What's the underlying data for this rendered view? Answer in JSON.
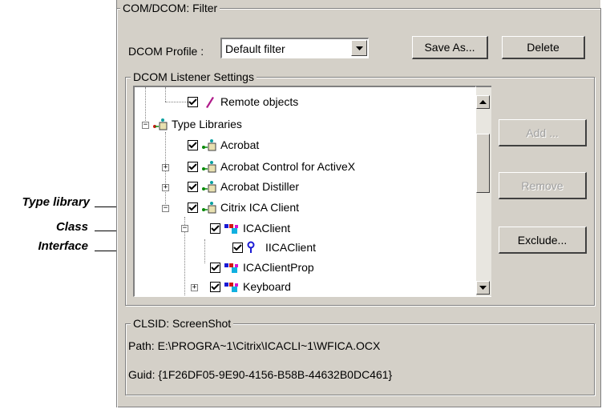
{
  "filter_group": {
    "title": "COM/DCOM: Filter"
  },
  "profile": {
    "label": "DCOM Profile :",
    "value": "Default filter"
  },
  "buttons": {
    "save_as": "Save As...",
    "delete": "Delete",
    "add": "Add ...",
    "remove": "Remove",
    "exclude": "Exclude..."
  },
  "listener_group": {
    "title": "DCOM Listener Settings"
  },
  "tree": {
    "items": [
      {
        "label": "Remote objects",
        "checked": true,
        "icon": "pencil-icon"
      },
      {
        "label": "Type Libraries",
        "checked": false,
        "icon": "type-library-icon"
      },
      {
        "label": "Acrobat",
        "checked": true,
        "icon": "type-library-icon"
      },
      {
        "label": "Acrobat Control for ActiveX",
        "checked": true,
        "icon": "type-library-icon"
      },
      {
        "label": "Acrobat Distiller",
        "checked": true,
        "icon": "type-library-icon"
      },
      {
        "label": "Citrix ICA Client",
        "checked": true,
        "icon": "type-library-icon"
      },
      {
        "label": "ICAClient",
        "checked": true,
        "icon": "class-icon"
      },
      {
        "label": "IICAClient",
        "checked": true,
        "icon": "interface-icon"
      },
      {
        "label": "ICAClientProp",
        "checked": true,
        "icon": "class-icon"
      },
      {
        "label": "Keyboard",
        "checked": true,
        "icon": "class-icon"
      }
    ]
  },
  "callouts": {
    "type_library": "Type library",
    "class": "Class",
    "interface": "Interface"
  },
  "clsid_group": {
    "title": "CLSID: ScreenShot",
    "path": "Path: E:\\PROGRA~1\\Citrix\\ICACLI~1\\WFICA.OCX",
    "guid": "Guid: {1F26DF05-9E90-4156-B58B-44632B0DC461}"
  },
  "colors": {
    "window_face": "#d4d0c8",
    "shadow": "#808080",
    "disabled_text": "#a0a0a0"
  }
}
